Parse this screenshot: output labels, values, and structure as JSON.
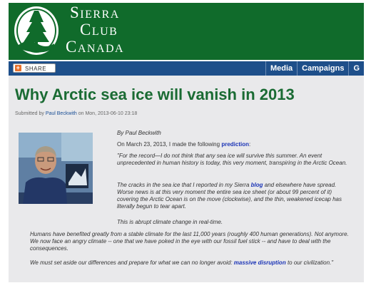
{
  "header": {
    "brand_line1": "Sierra",
    "brand_line2": "Club",
    "brand_line3": "Canada"
  },
  "navbar": {
    "share_label": "SHARE",
    "items": [
      {
        "label": "Media"
      },
      {
        "label": "Campaigns"
      },
      {
        "label": "G"
      }
    ]
  },
  "article": {
    "title": "Why Arctic sea ice will vanish in 2013",
    "submitted_prefix": "Submitted by ",
    "author": "Paul Beckwith",
    "submitted_suffix": " on Mon, 2013-06-10 23:18",
    "byline": "By Paul Beckwith",
    "intro_text": "On March 23, 2013, I made the following ",
    "intro_link": "prediction",
    "intro_end": ":",
    "quote": "\"For the record—I do not think that any sea ice will survive this summer. An event unprecedented in human history is today, this very moment, transpiring in the Arctic Ocean.",
    "para2_a": "The cracks in the sea ice that I reported in my Sierra ",
    "para2_link": "blog",
    "para2_b": " and elsewhere have spread. Worse news is at this very moment the entire sea ice sheet (or about 99 percent of it) covering the Arctic Ocean is on the move (clockwise), and the thin, weakened icecap has literally begun to tear apart.",
    "para3": "This is abrupt climate change in real-time.",
    "para4": "Humans have benefited greatly from a stable climate for the last 11,000 years (roughly 400 human generations). Not anymore. We now face an angry climate -- one that we have poked in the eye with our fossil fuel stick -- and have to deal with the consequences.",
    "para5_a": "We must set aside our differences and prepare for what we can no longer avoid: ",
    "para5_link": "massive disruption",
    "para5_b": " to our civilization.\""
  },
  "colors": {
    "header_green": "#106b2b",
    "title_green": "#1a6b33",
    "nav_blue": "#1e4f8a",
    "link_blue": "#1b34b6",
    "content_bg": "#e9e9eb"
  }
}
